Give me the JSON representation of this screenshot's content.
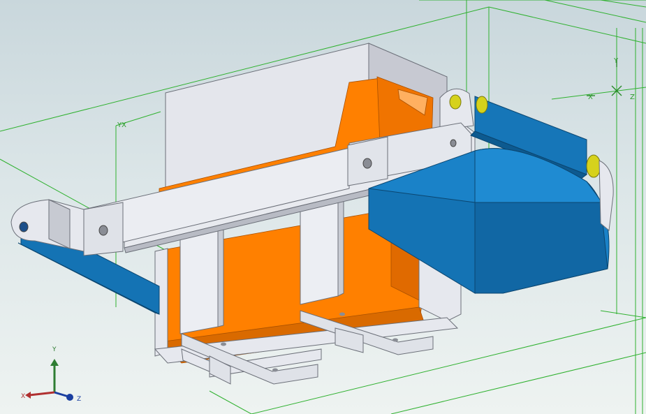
{
  "viewport": {
    "background_top": "#c9d7dc",
    "background_bottom": "#eef3f1"
  },
  "colors": {
    "grid": "#2fb12f",
    "grey_panel": "#e3e6ec",
    "grey_edge": "#6b6f78",
    "orange": "#ff8000",
    "orange_dark": "#d96a00",
    "blue": "#1473b4",
    "blue_dark": "#0e5a90",
    "yellow": "#d6d21c"
  },
  "grid_labels": {
    "left_plane": "YX",
    "right_plane_x": "X",
    "right_plane_y": "Y",
    "right_plane_z": "Z"
  },
  "triad": {
    "x_label": "X",
    "y_label": "Y",
    "z_label": "Z",
    "x_color": "#b03030",
    "y_color": "#2e7d32",
    "z_color": "#1a3fa0"
  },
  "icons": {
    "axis_triad": "axis-triad-icon",
    "origin_marker": "origin-crosshair-icon"
  }
}
